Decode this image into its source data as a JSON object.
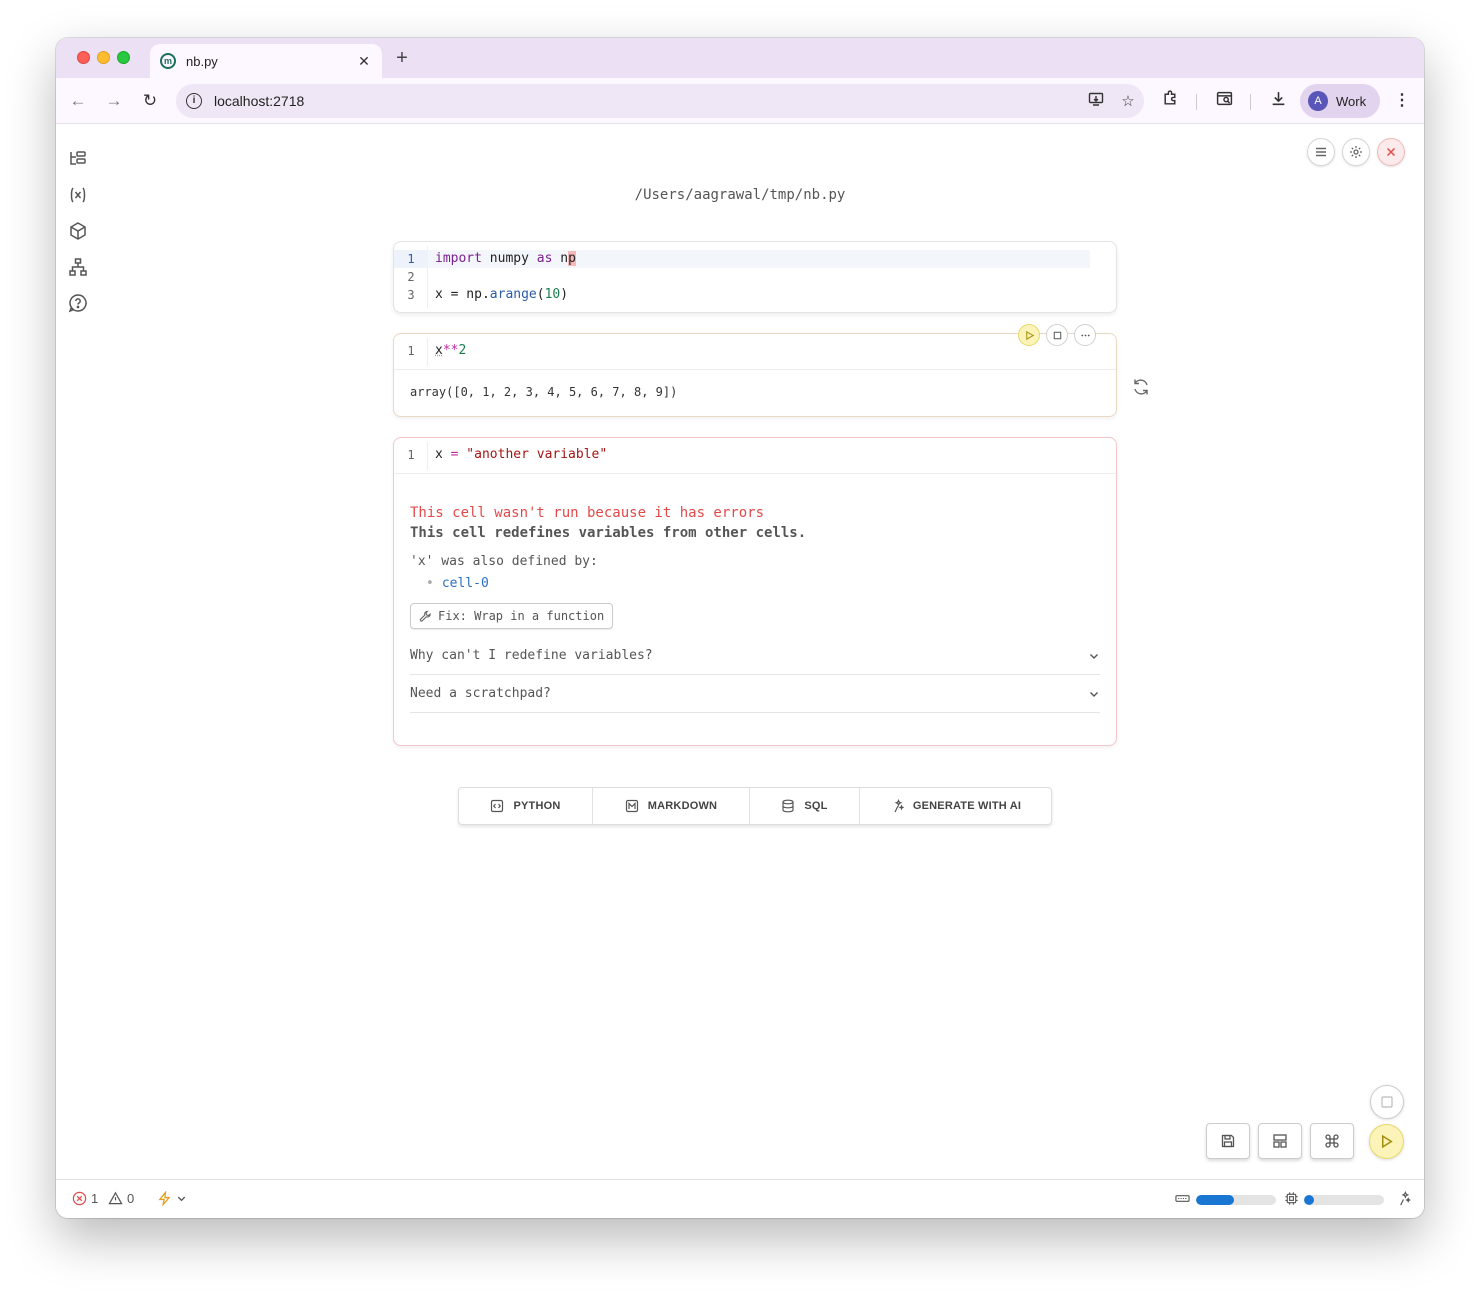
{
  "browser": {
    "tab_title": "nb.py",
    "tab_favicon": "m",
    "url": "localhost:2718",
    "profile_initial": "A",
    "profile_name": "Work"
  },
  "notebook": {
    "filename": "/Users/aagrawal/tmp/nb.py",
    "cells": [
      {
        "line_numbers": [
          "1",
          "2",
          "3"
        ],
        "code_line_1": {
          "kw1": "import",
          "mod": " numpy ",
          "kw2": "as",
          "sp": " n",
          "hl": "p"
        },
        "code_line_3": {
          "lhs": "x = np.",
          "fn": "arange",
          "open": "(",
          "num": "10",
          "close": ")"
        }
      },
      {
        "line_numbers": [
          "1"
        ],
        "code": {
          "var": "x",
          "op": "**",
          "num": "2"
        },
        "output": "array([0, 1, 2, 3, 4, 5, 6, 7, 8, 9])"
      },
      {
        "line_numbers": [
          "1"
        ],
        "code": {
          "lhs": "x ",
          "op": "=",
          "str": " \"another variable\""
        },
        "error_title": "This cell wasn't run because it has errors",
        "error_desc": "This cell redefines variables from other cells.",
        "error_sub": "'x' was also defined by:",
        "error_ref": "cell-0",
        "fix_label": "Fix: Wrap in a function",
        "accordion_1": "Why can't I redefine variables?",
        "accordion_2": "Need a scratchpad?"
      }
    ]
  },
  "add_cell_bar": {
    "python": "PYTHON",
    "markdown": "MARKDOWN",
    "sql": "SQL",
    "ai": "GENERATE WITH AI"
  },
  "status": {
    "errors": "1",
    "warnings": "0",
    "memory_fraction": 0.48,
    "cpu_fraction": 0.12
  },
  "colors": {
    "accent_run": "#fbf3b8",
    "error": "#e24a4a",
    "progress": "#1976d2"
  }
}
